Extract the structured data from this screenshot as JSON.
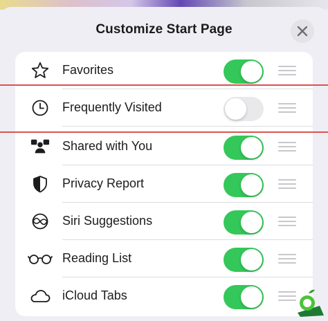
{
  "sheet": {
    "title": "Customize Start Page",
    "close_icon": "close-icon"
  },
  "items": [
    {
      "label": "Favorites",
      "icon": "star-icon",
      "enabled": true
    },
    {
      "label": "Frequently Visited",
      "icon": "clock-icon",
      "enabled": false
    },
    {
      "label": "Shared with You",
      "icon": "people-shared-icon",
      "enabled": true
    },
    {
      "label": "Privacy Report",
      "icon": "shield-icon",
      "enabled": true
    },
    {
      "label": "Siri Suggestions",
      "icon": "siri-icon",
      "enabled": true
    },
    {
      "label": "Reading List",
      "icon": "glasses-icon",
      "enabled": true
    },
    {
      "label": "iCloud Tabs",
      "icon": "cloud-icon",
      "enabled": true
    }
  ],
  "colors": {
    "toggle_on": "#34c759",
    "toggle_off": "#e9e9eb",
    "highlight": "#d9534f"
  }
}
